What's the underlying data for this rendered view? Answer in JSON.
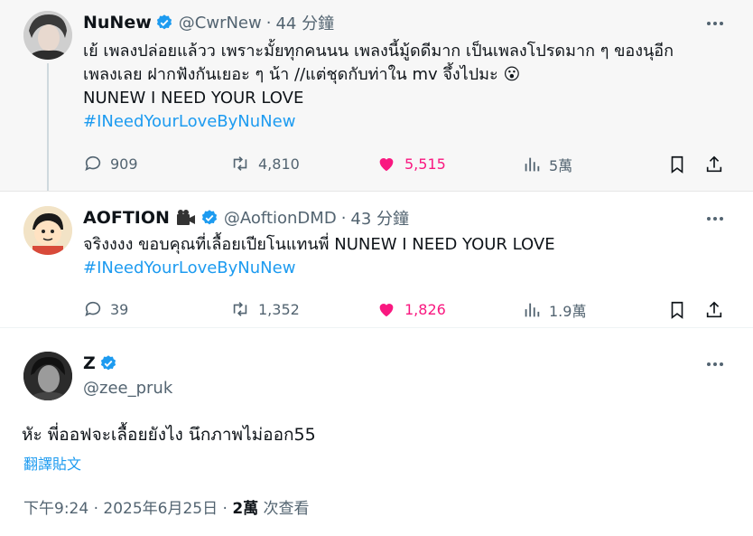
{
  "tweets": [
    {
      "name": "NuNew",
      "handle": "@CwrNew",
      "sep": "·",
      "time": "44 分鐘",
      "lines": [
        "เย้ เพลงปล่อยแล้วว เพราะมั้ยทุกคนนน เพลงนี้มู้ดดีมาก เป็นเพลงโปรดมาก ๆ ของนุอีก",
        "เพลงเลย ฝากฟังกันเยอะ ๆ น้า //แต่ชุดกับท่าใน mv จึ้งไปมะ"
      ],
      "emoji": "😮",
      "line3": "NUNEW I NEED YOUR LOVE",
      "hashtag": "#INeedYourLoveByNuNew",
      "replies": "909",
      "retweets": "4,810",
      "likes": "5,515",
      "views": "5萬"
    },
    {
      "name": "AOFTION",
      "handle": "@AoftionDMD",
      "sep": "·",
      "time": "43 分鐘",
      "line1": "จริงงงง ขอบคุณที่เลื้อยเปียโนแทนพี่ NUNEW I NEED YOUR LOVE",
      "hashtag": "#INeedYourLoveByNuNew",
      "replies": "39",
      "retweets": "1,352",
      "likes": "1,826",
      "views": "1.9萬"
    },
    {
      "name": "Z",
      "handle": "@zee_pruk",
      "text": "หัะ พี่ออฟจะเลื้อยยังไง นึกภาพไม่ออก55",
      "translate": "翻譯貼文",
      "time_meta": "下午9:24 · 2025年6月25日 · ",
      "views_count": "2萬",
      "views_label": " 次查看"
    }
  ],
  "colors": {
    "accent": "#1d9bf0",
    "like": "#f91880",
    "muted": "#536471",
    "text": "#0f1419"
  },
  "icons": [
    "verified-badge-icon",
    "more-icon",
    "reply-icon",
    "retweet-icon",
    "heart-icon",
    "views-icon",
    "bookmark-icon",
    "share-icon",
    "camera-icon"
  ]
}
